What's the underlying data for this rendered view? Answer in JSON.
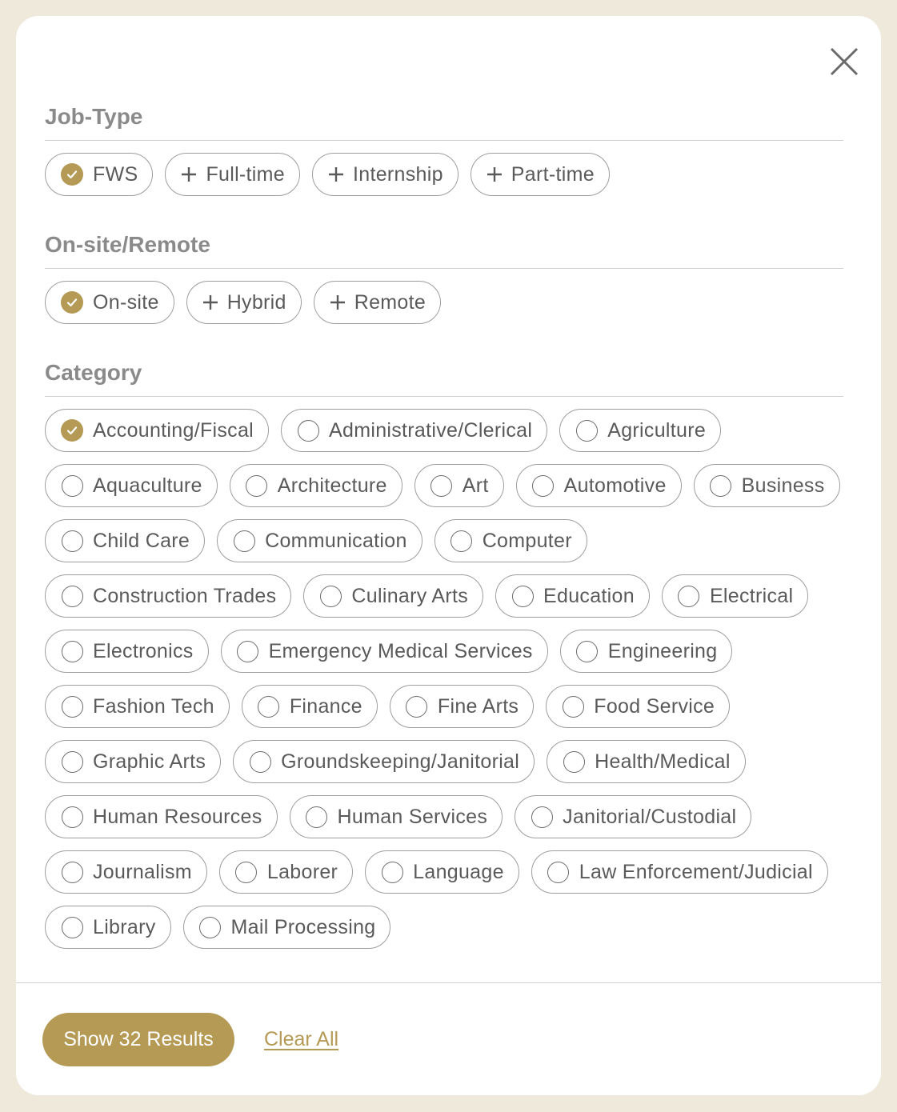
{
  "colors": {
    "accent": "#b59a55",
    "text": "#5a5a5a",
    "heading": "#8a8a8a",
    "border": "#9e9e9e",
    "frame": "#efe9dc"
  },
  "close_icon": "close-icon",
  "sections": [
    {
      "title": "Job-Type",
      "chips": [
        {
          "label": "FWS",
          "state": "checked"
        },
        {
          "label": "Full-time",
          "state": "plus"
        },
        {
          "label": "Internship",
          "state": "plus"
        },
        {
          "label": "Part-time",
          "state": "plus"
        }
      ]
    },
    {
      "title": "On-site/Remote",
      "chips": [
        {
          "label": "On-site",
          "state": "checked"
        },
        {
          "label": "Hybrid",
          "state": "plus"
        },
        {
          "label": "Remote",
          "state": "plus"
        }
      ]
    },
    {
      "title": "Category",
      "chips": [
        {
          "label": "Accounting/Fiscal",
          "state": "checked"
        },
        {
          "label": "Administrative/Clerical",
          "state": "radio"
        },
        {
          "label": "Agriculture",
          "state": "radio"
        },
        {
          "label": "Aquaculture",
          "state": "radio"
        },
        {
          "label": "Architecture",
          "state": "radio"
        },
        {
          "label": "Art",
          "state": "radio"
        },
        {
          "label": "Automotive",
          "state": "radio"
        },
        {
          "label": "Business",
          "state": "radio"
        },
        {
          "label": "Child Care",
          "state": "radio"
        },
        {
          "label": "Communication",
          "state": "radio"
        },
        {
          "label": "Computer",
          "state": "radio"
        },
        {
          "label": "Construction Trades",
          "state": "radio"
        },
        {
          "label": "Culinary Arts",
          "state": "radio"
        },
        {
          "label": "Education",
          "state": "radio"
        },
        {
          "label": "Electrical",
          "state": "radio"
        },
        {
          "label": "Electronics",
          "state": "radio"
        },
        {
          "label": "Emergency Medical Services",
          "state": "radio"
        },
        {
          "label": "Engineering",
          "state": "radio"
        },
        {
          "label": "Fashion Tech",
          "state": "radio"
        },
        {
          "label": "Finance",
          "state": "radio"
        },
        {
          "label": "Fine Arts",
          "state": "radio"
        },
        {
          "label": "Food Service",
          "state": "radio"
        },
        {
          "label": "Graphic Arts",
          "state": "radio"
        },
        {
          "label": "Groundskeeping/Janitorial",
          "state": "radio"
        },
        {
          "label": "Health/Medical",
          "state": "radio"
        },
        {
          "label": "Human Resources",
          "state": "radio"
        },
        {
          "label": "Human Services",
          "state": "radio"
        },
        {
          "label": "Janitorial/Custodial",
          "state": "radio"
        },
        {
          "label": "Journalism",
          "state": "radio"
        },
        {
          "label": "Laborer",
          "state": "radio"
        },
        {
          "label": "Language",
          "state": "radio"
        },
        {
          "label": "Law Enforcement/Judicial",
          "state": "radio"
        },
        {
          "label": "Library",
          "state": "radio"
        },
        {
          "label": "Mail Processing",
          "state": "radio"
        }
      ]
    }
  ],
  "footer": {
    "show_results_label": "Show 32 Results",
    "clear_all_label": "Clear All"
  }
}
